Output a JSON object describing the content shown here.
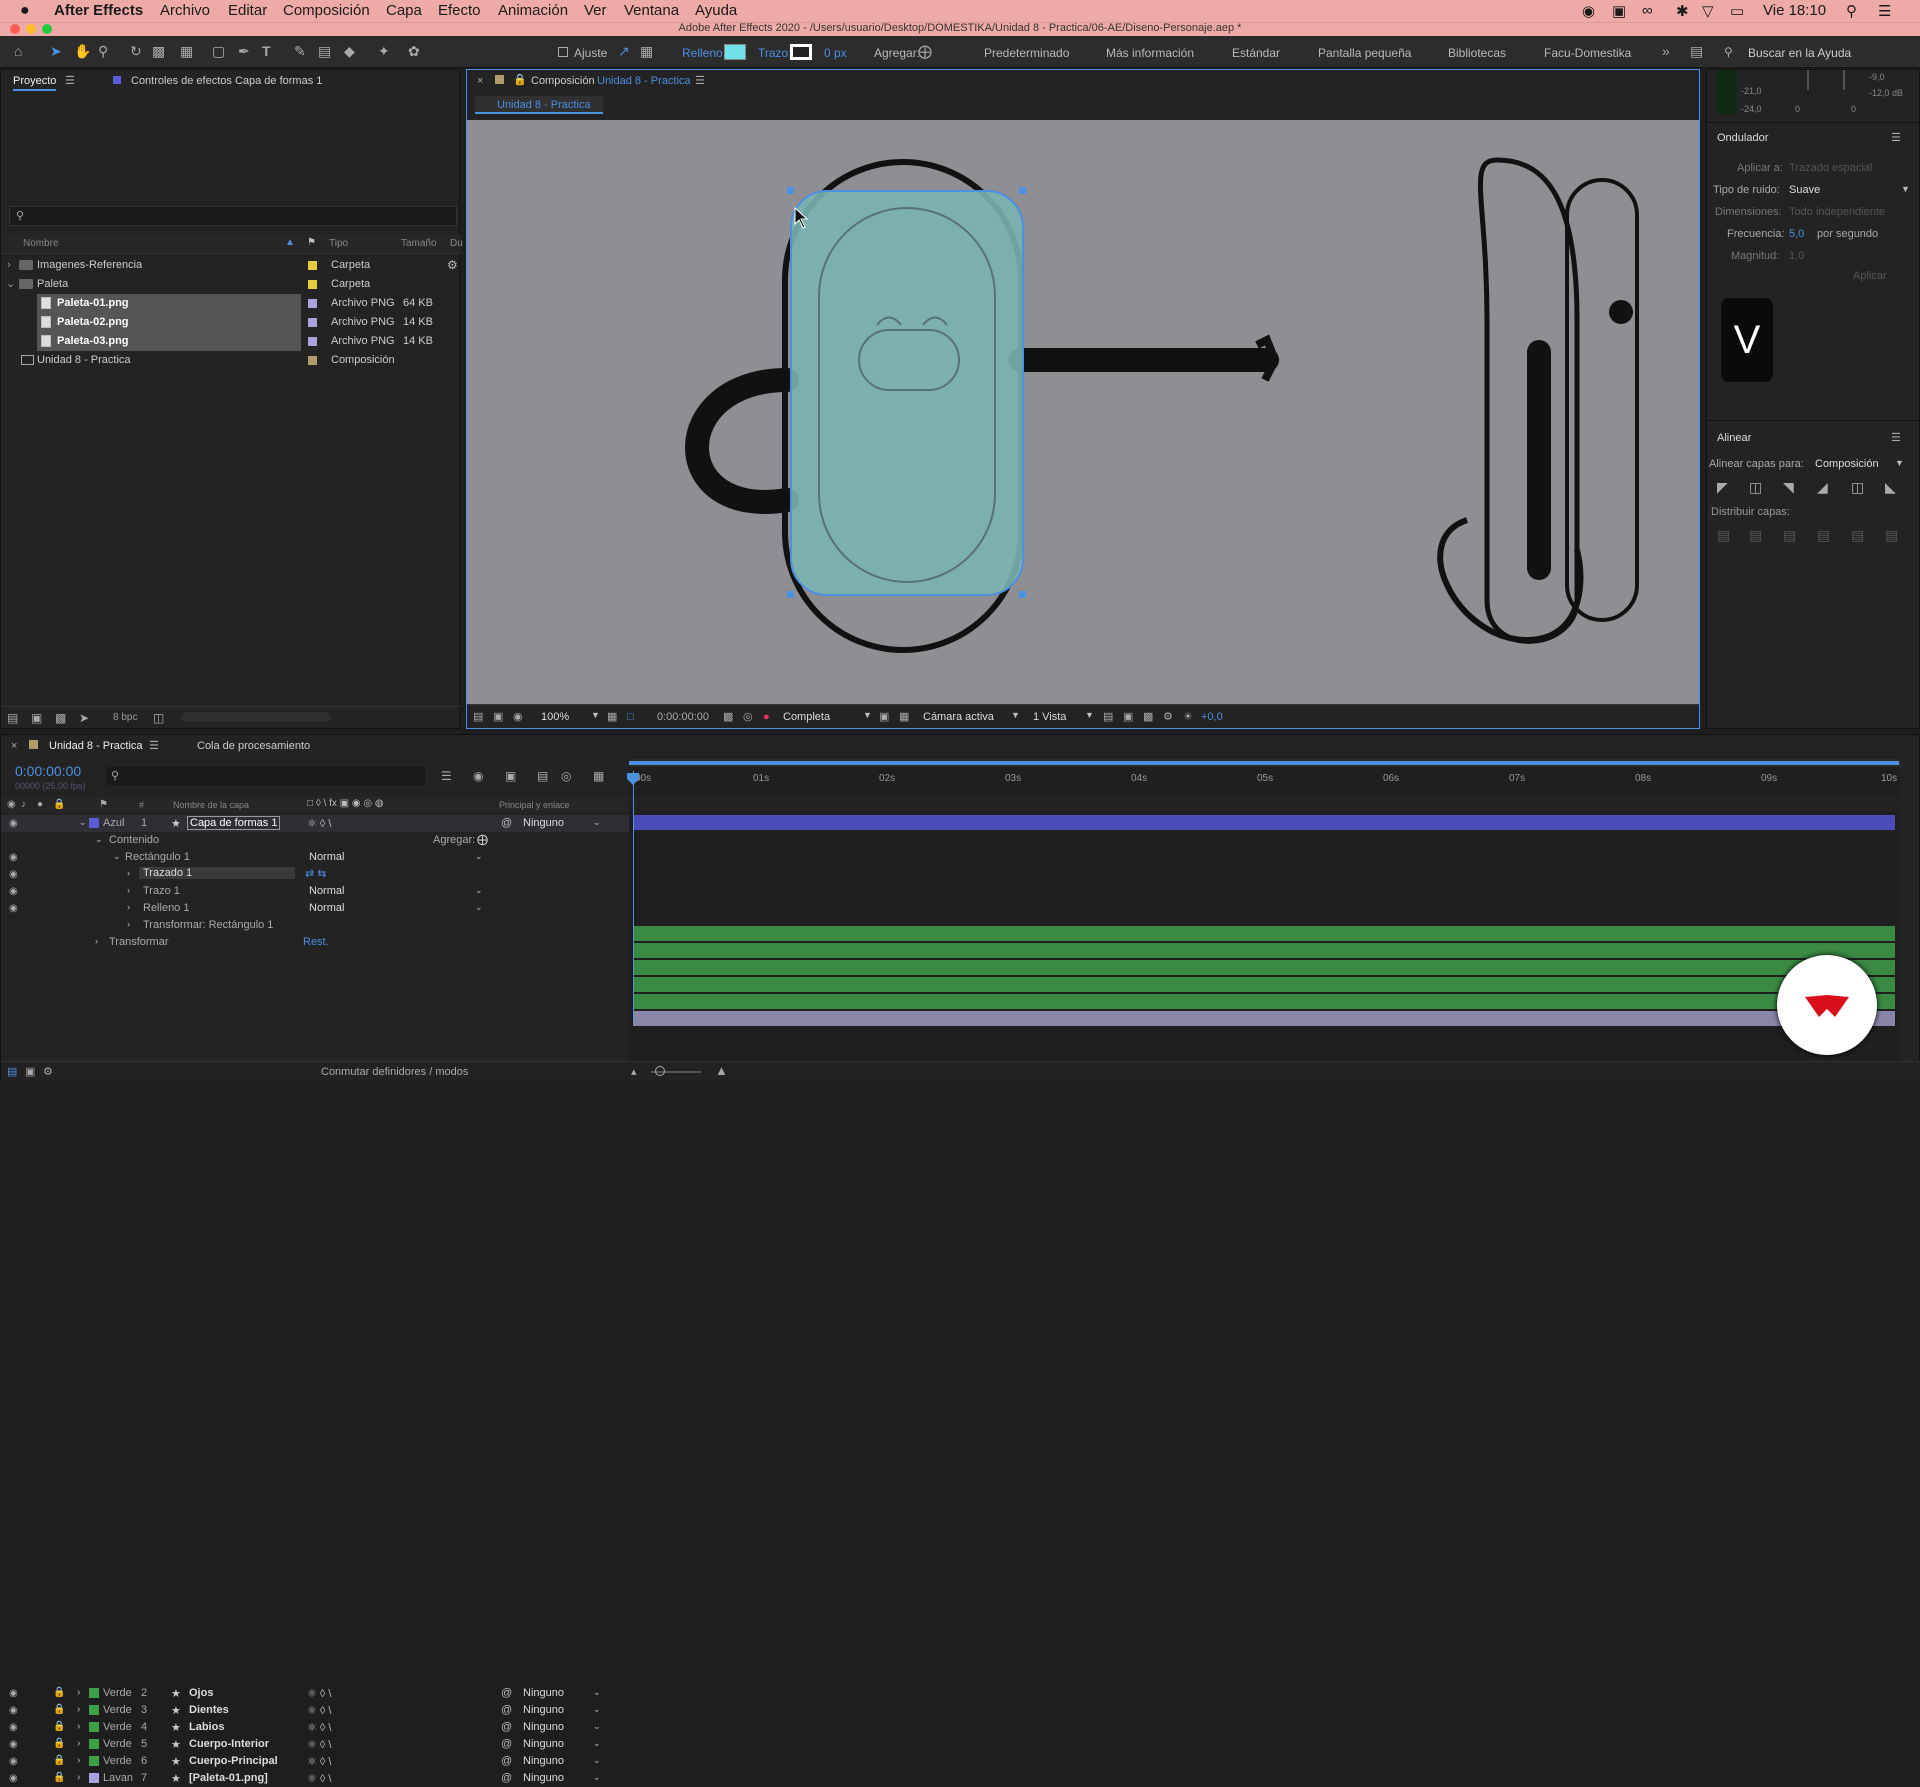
{
  "menubar": {
    "apple": "",
    "app": "After Effects",
    "items": [
      "Archivo",
      "Editar",
      "Composición",
      "Capa",
      "Efecto",
      "Animación",
      "Ver",
      "Ventana",
      "Ayuda"
    ],
    "clock": "Vie 18:10",
    "title": "Adobe After Effects 2020 - /Users/usuario/Desktop/DOMESTIKA/Unidad 8 - Practica/06-AE/Diseno-Personaje.aep *"
  },
  "toolbar": {
    "ajuste": "Ajuste",
    "relleno": "Relleno:",
    "trazo": "Trazo:",
    "px": "0 px",
    "agregar": "Agregar:",
    "workspaces": [
      "Predeterminado",
      "Más información",
      "Estándar",
      "Pantalla pequeña",
      "Bibliotecas",
      "Facu-Domestika"
    ],
    "help_placeholder": "Buscar en la Ayuda"
  },
  "project": {
    "tab": "Proyecto",
    "effects_tab": "Controles de efectos Capa de formas 1",
    "col_name": "Nombre",
    "col_type": "Tipo",
    "col_size": "Tamaño",
    "col_du": "Du",
    "items": [
      {
        "name": "Imagenes-Referencia",
        "type": "Carpeta",
        "size": ""
      },
      {
        "name": "Paleta",
        "type": "Carpeta",
        "size": ""
      },
      {
        "name": "Paleta-01.png",
        "type": "Archivo PNG",
        "size": "64 KB"
      },
      {
        "name": "Paleta-02.png",
        "type": "Archivo PNG",
        "size": "14 KB"
      },
      {
        "name": "Paleta-03.png",
        "type": "Archivo PNG",
        "size": "14 KB"
      },
      {
        "name": "Unidad 8 - Practica",
        "type": "Composición",
        "size": ""
      }
    ],
    "bpc": "8 bpc"
  },
  "composition": {
    "tab_prefix": "Composición",
    "tab_name": "Unidad 8 - Practica",
    "breadcrumb": "Unidad 8 - Practica",
    "zoom": "100%",
    "time": "0:00:00:00",
    "resolution": "Completa",
    "camera": "Cámara activa",
    "views": "1 Vista",
    "exposure": "+0,0"
  },
  "audio": {
    "levels": [
      "-9,0",
      "-12,0 dB",
      "-21,0",
      "-24,0",
      "0",
      "0"
    ]
  },
  "wiggler": {
    "title": "Ondulador",
    "apply_to": "Aplicar a:",
    "apply_to_val": "Trazado espacial",
    "noise": "Tipo de ruido:",
    "noise_val": "Suave",
    "dims": "Dimensiones:",
    "dims_val": "Todo independiente",
    "freq": "Frecuencia:",
    "freq_val": "5,0",
    "freq_unit": "por segundo",
    "mag": "Magnitud:",
    "mag_val": "1,0",
    "apply_btn": "Aplicar"
  },
  "key_badge": "V",
  "align": {
    "title": "Alinear",
    "align_to": "Alinear capas para:",
    "align_to_val": "Composición",
    "distribute": "Distribuir capas:"
  },
  "timeline": {
    "tab": "Unidad 8 - Practica",
    "queue_tab": "Cola de procesamiento",
    "time": "0:00:00:00",
    "fps": "00000 (25.00 fps)",
    "col_layer": "Nombre de la capa",
    "col_parent": "Principal y enlace",
    "ruler": [
      "00s",
      "01s",
      "02s",
      "03s",
      "04s",
      "05s",
      "06s",
      "07s",
      "08s",
      "09s",
      "10s"
    ],
    "layer1": {
      "color": "Azul",
      "num": "1",
      "name": "Capa de formas 1",
      "parent": "Ninguno"
    },
    "contenido": "Contenido",
    "agregar": "Agregar:",
    "rect": "Rectángulo 1",
    "rect_mode": "Normal",
    "trazado": "Trazado 1",
    "trazo": "Trazo 1",
    "trazo_mode": "Normal",
    "relleno": "Relleno 1",
    "relleno_mode": "Normal",
    "transf_rect": "Transformar: Rectángulo 1",
    "transformar": "Transformar",
    "rest": "Rest.",
    "layers": [
      {
        "color": "Verde",
        "num": "2",
        "name": "Ojos",
        "parent": "Ninguno"
      },
      {
        "color": "Verde",
        "num": "3",
        "name": "Dientes",
        "parent": "Ninguno"
      },
      {
        "color": "Verde",
        "num": "4",
        "name": "Labios",
        "parent": "Ninguno"
      },
      {
        "color": "Verde",
        "num": "5",
        "name": "Cuerpo-Interior",
        "parent": "Ninguno"
      },
      {
        "color": "Verde",
        "num": "6",
        "name": "Cuerpo-Principal",
        "parent": "Ninguno"
      },
      {
        "color": "Lavan",
        "num": "7",
        "name": "[Paleta-01.png]",
        "parent": "Ninguno"
      }
    ],
    "footer": "Conmutar definidores / modos"
  },
  "colors": {
    "menubar": "#eeaaa6",
    "accent": "#4d8fe0",
    "green": "#3f9e48",
    "blue": "#5b5bd6",
    "shape_fill": "#7ab4b3"
  }
}
